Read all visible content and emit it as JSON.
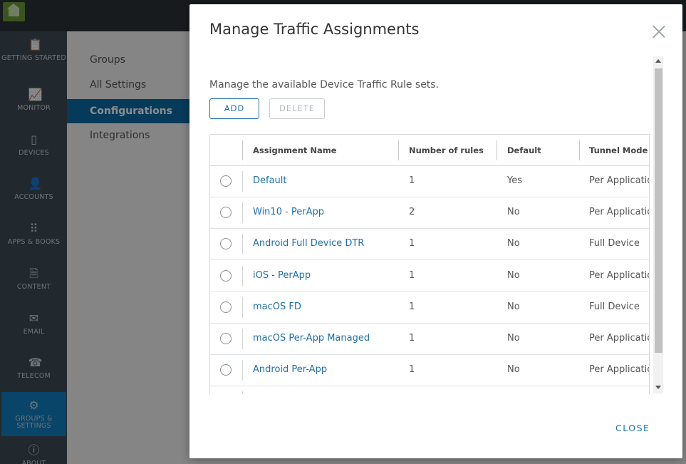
{
  "background": {
    "nav_items": [
      {
        "label": "GETTING STARTED",
        "icon": "clipboard-icon",
        "glyph": "📋"
      },
      {
        "label": "MONITOR",
        "icon": "monitor-icon",
        "glyph": "📈"
      },
      {
        "label": "DEVICES",
        "icon": "device-icon",
        "glyph": "▯"
      },
      {
        "label": "ACCOUNTS",
        "icon": "user-icon",
        "glyph": "👤"
      },
      {
        "label": "APPS & BOOKS",
        "icon": "apps-grid-icon",
        "glyph": "⠿"
      },
      {
        "label": "CONTENT",
        "icon": "document-icon",
        "glyph": "🗎"
      },
      {
        "label": "EMAIL",
        "icon": "mail-icon",
        "glyph": "✉"
      },
      {
        "label": "TELECOM",
        "icon": "phone-icon",
        "glyph": "☎"
      },
      {
        "label": "GROUPS & SETTINGS",
        "icon": "gear-icon",
        "glyph": "⚙"
      },
      {
        "label": "ABOUT",
        "icon": "info-icon",
        "glyph": "ⓘ"
      }
    ],
    "sub_items": [
      "Groups",
      "All Settings",
      "Configurations",
      "Integrations"
    ]
  },
  "modal": {
    "title": "Manage Traffic Assignments",
    "description": "Manage the available Device Traffic Rule sets.",
    "add_label": "ADD",
    "delete_label": "DELETE",
    "close_label": "CLOSE",
    "columns": [
      "Assignment Name",
      "Number of rules",
      "Default",
      "Tunnel Mode"
    ],
    "rows": [
      {
        "name": "Default",
        "rules": "1",
        "default": "Yes",
        "tunnel": "Per Application"
      },
      {
        "name": "Win10 - PerApp",
        "rules": "2",
        "default": "No",
        "tunnel": "Per Application"
      },
      {
        "name": "Android Full Device DTR",
        "rules": "1",
        "default": "No",
        "tunnel": "Full Device"
      },
      {
        "name": "iOS - PerApp",
        "rules": "1",
        "default": "No",
        "tunnel": "Per Application"
      },
      {
        "name": "macOS FD",
        "rules": "1",
        "default": "No",
        "tunnel": "Full Device"
      },
      {
        "name": "macOS Per-App Managed",
        "rules": "1",
        "default": "No",
        "tunnel": "Per Application"
      },
      {
        "name": "Android Per-App",
        "rules": "1",
        "default": "No",
        "tunnel": "Per Application"
      }
    ]
  },
  "colors": {
    "accent": "#1a73ab",
    "nav_active": "#117cbf",
    "nav_bg": "#3f4c55"
  }
}
